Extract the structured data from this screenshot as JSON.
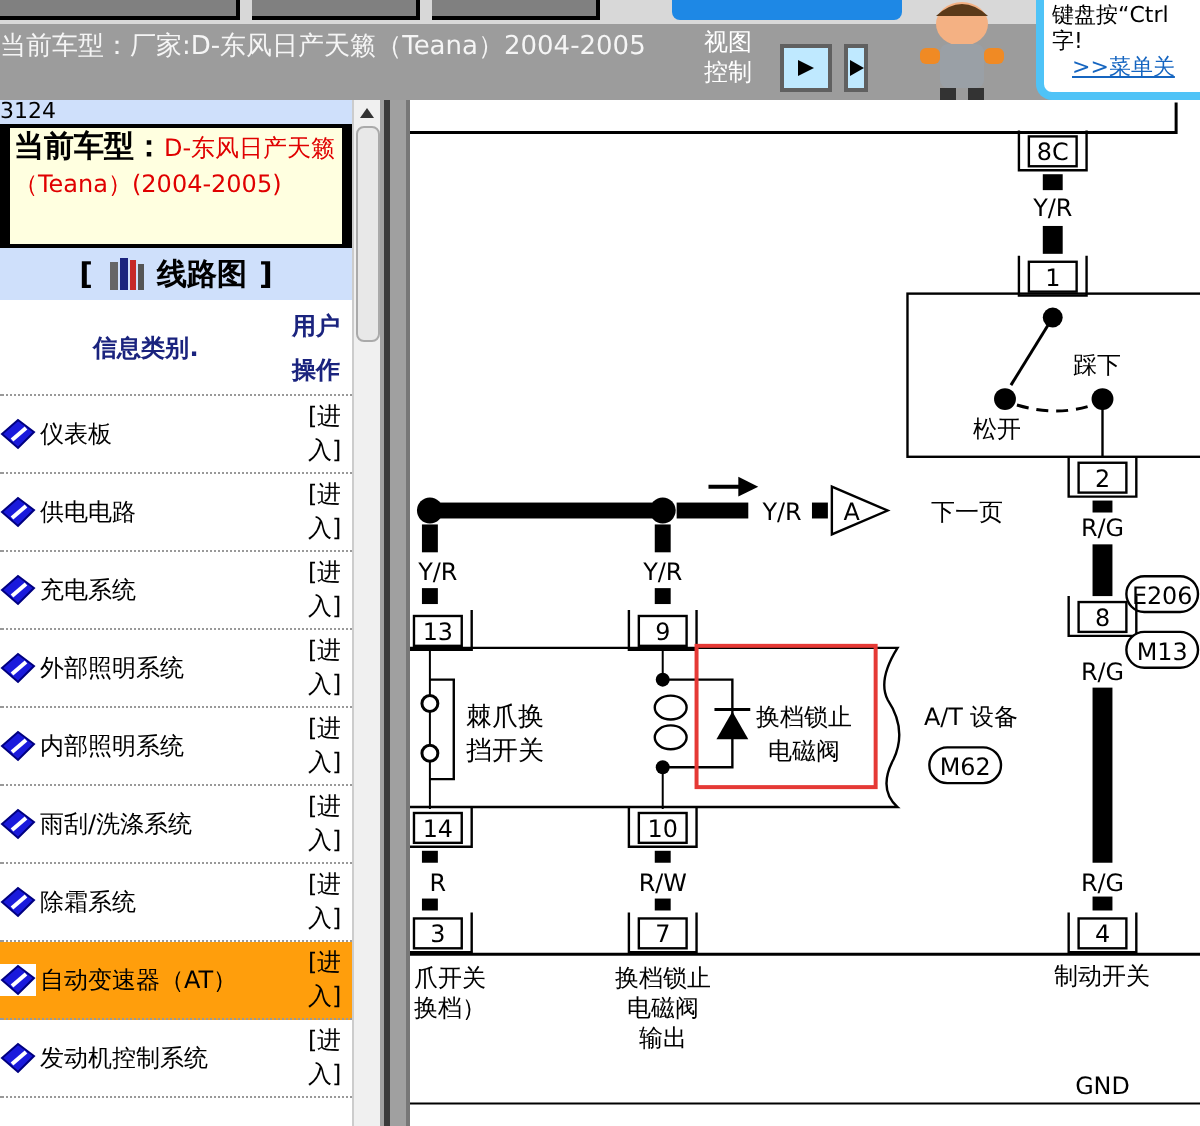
{
  "header": {
    "title": "当前车型：厂家:D-东风日产天籁（Teana）2004-2005",
    "view_control": "视图控制",
    "tooltip_lines": [
      "键盘按“Ctrl",
      "字!"
    ],
    "tooltip_link": ">>菜单关"
  },
  "sidebar": {
    "code": "3124",
    "current_label": "当前车型：",
    "current_value": "D-东风日产天籁（Teana）(2004-2005)",
    "section_open": "[",
    "section_title": "线路图",
    "section_close": "]",
    "col_category": "信息类别.",
    "col_action": "用户操作",
    "items": [
      {
        "label": "仪表板",
        "action": "[进入]",
        "selected": false
      },
      {
        "label": "供电电路",
        "action": "[进入]",
        "selected": false
      },
      {
        "label": "充电系统",
        "action": "[进入]",
        "selected": false
      },
      {
        "label": "外部照明系统",
        "action": "[进入]",
        "selected": false
      },
      {
        "label": "内部照明系统",
        "action": "[进入]",
        "selected": false
      },
      {
        "label": "雨刮/洗涤系统",
        "action": "[进入]",
        "selected": false
      },
      {
        "label": "除霜系统",
        "action": "[进入]",
        "selected": false
      },
      {
        "label": "自动变速器（AT）",
        "action": "[进入]",
        "selected": true
      },
      {
        "label": "发动机控制系统",
        "action": "[进入]",
        "selected": false
      }
    ]
  },
  "diagram": {
    "pin_8c": "8C",
    "wire_top": "Y/R",
    "pin_1": "1",
    "pressed": "踩下",
    "released": "松开",
    "pin_2": "2",
    "wire_rg_1": "R/G",
    "connector_e206": "E206",
    "pin_8": "8",
    "connector_m13": "M13",
    "wire_rg_2": "R/G",
    "wire_rg_3": "R/G",
    "pin_4": "4",
    "brake_switch": "制动开关",
    "gnd": "GND",
    "wire_arrow": "Y/R",
    "offpage": "A",
    "next_page": "下一页",
    "wire_left": "Y/R",
    "wire_mid": "Y/R",
    "pin_13": "13",
    "pin_9": "9",
    "pawl_switch": [
      "棘爪换",
      "挡开关"
    ],
    "solenoid": [
      "换档锁止",
      "电磁阀"
    ],
    "at_device": "A/T 设备",
    "connector_m62": "M62",
    "pin_14": "14",
    "pin_10": "10",
    "wire_r": "R",
    "wire_rw": "R/W",
    "pin_3": "3",
    "pin_7": "7",
    "left_label": [
      "爪开关",
      "换档）"
    ],
    "output_label": [
      "换档锁止",
      "电磁阀",
      "输出"
    ]
  }
}
